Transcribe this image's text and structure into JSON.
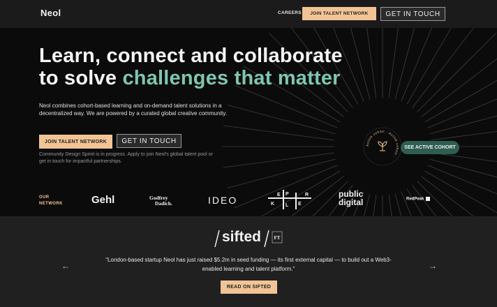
{
  "nav": {
    "brand": "Neol",
    "careers": "CAREERS",
    "join": "JOIN TALENT NETWORK",
    "touch": "GET IN TOUCH"
  },
  "hero": {
    "title_line1": "Learn, connect and collaborate",
    "title_line2_plain": "to solve ",
    "title_line2_accent": "challenges that matter",
    "description": "Neol combines cohort-based learning and on-demand talent solutions in a decentralized way. We are powered by a curated global creative community.",
    "join": "JOIN TALENT NETWORK",
    "touch": "GET IN TOUCH",
    "note": "Community Design Sprint is in progress. Apply to join Neol's global talent pool or get in touch for impactful partnerships.",
    "active_circle_text": "Active cohort · Active cohort ·",
    "see_cohort": "SEE ACTIVE COHORT"
  },
  "network": {
    "label_line1": "OUR",
    "label_line2": "NETWORK",
    "logos": {
      "gehl": "Gehl",
      "godfrey_1": "Godfrey",
      "godfrey_2": "Dadich.",
      "ideo": "IDEO",
      "kepler": [
        "K",
        "E",
        "P",
        "L",
        "E",
        "R"
      ],
      "public_1": "public",
      "public_2": "digital",
      "redpeak": "RedPeak"
    }
  },
  "press": {
    "publication": "sifted",
    "ft_badge": "FT",
    "quote": "\"London-based startup Neol has just raised $5.2m in seed funding — its first external capital — to build out a Web3-enabled learning and talent platform.\"",
    "read_button": "READ ON SIFTED",
    "prev": "←",
    "next": "→"
  },
  "colors": {
    "accent_green": "#7dc6b2",
    "accent_orange": "#f2c495",
    "cohort_green": "#2f5d52",
    "background": "#0b0b0b"
  }
}
